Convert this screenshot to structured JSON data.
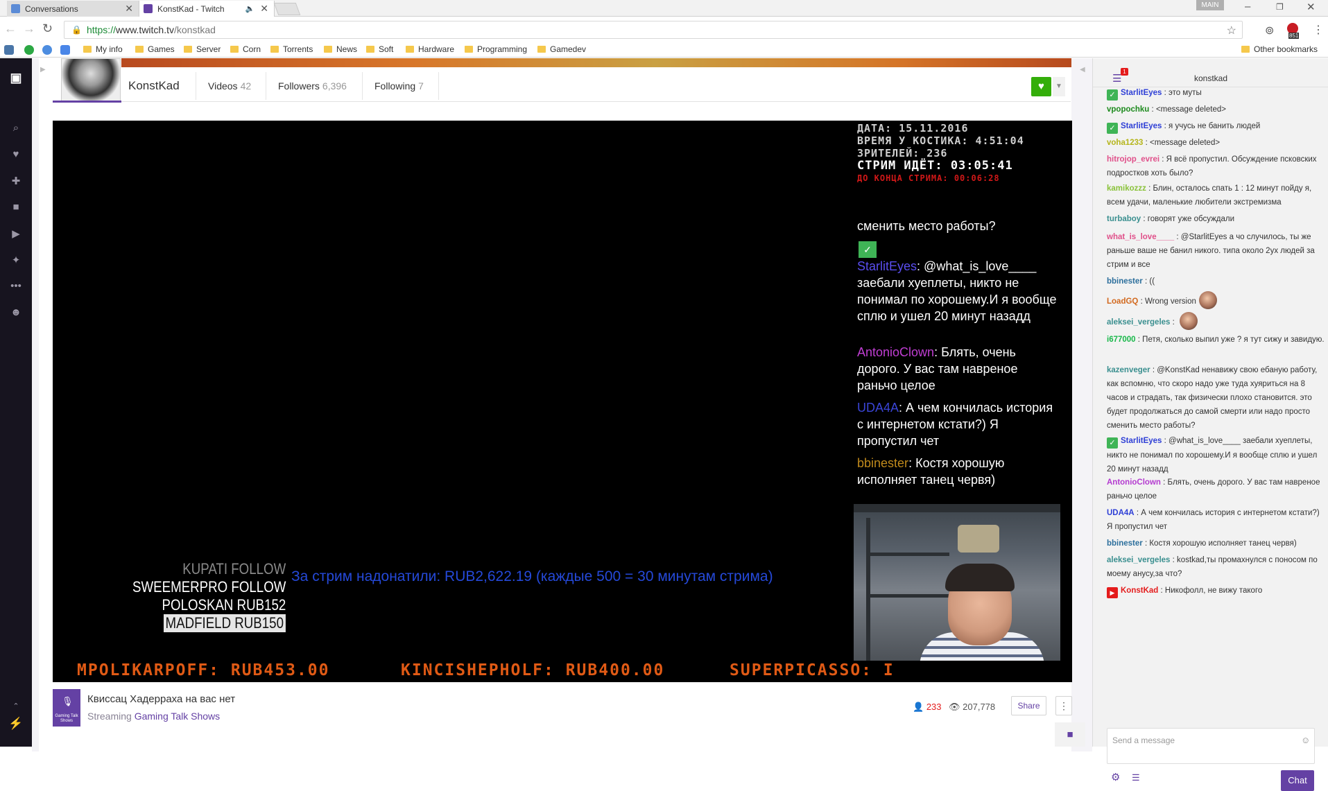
{
  "browser": {
    "tabs": [
      {
        "title": "Conversations",
        "favicon_color": "#5b8bd6"
      },
      {
        "title": "KonstKad - Twitch",
        "favicon_color": "#6441a4"
      }
    ],
    "profile_badge": "MAIN",
    "url": {
      "scheme": "https://",
      "host": "www.twitch.tv",
      "path": "/konstkad"
    },
    "bookmarks": [
      "My info",
      "Games",
      "Server",
      "Corn",
      "Torrents",
      "News",
      "Soft",
      "Hardware",
      "Programming",
      "Gamedev"
    ],
    "other_bookmarks": "Other bookmarks",
    "extension_badge": "851"
  },
  "channel": {
    "name": "KonstKad",
    "stats": [
      {
        "label": "Videos",
        "value": "42"
      },
      {
        "label": "Followers",
        "value": "6,396"
      },
      {
        "label": "Following",
        "value": "7"
      }
    ]
  },
  "player": {
    "info_lines": [
      "ДАТА: 15.11.2016",
      "ВРЕМЯ У КОСТИКА: 4:51:04",
      "ЗРИТЕЛЕЙ: 236",
      "СТРИМ ИДЁТ: 03:05:41",
      "ДО КОНЦА СТРИМА: 00:06:28"
    ],
    "overlay_chat_intro": "сменить место работы?",
    "overlay_chat": [
      {
        "user": "StarlitEyes",
        "text": "@what_is_love____ заебали хуеплеты, никто не понимал по хорошему.И я вообще сплю и ушел 20 минут назадд",
        "color": "#5a4ef0"
      },
      {
        "user": "AntonioClown",
        "text": "Блять, очень дорого. У вас там навреное раньчо целое",
        "color": "#c03ed3"
      },
      {
        "user": "UDA4A",
        "text": "А чем кончилась история с интернетом кстати?) Я пропустил чет",
        "color": "#3a45d6"
      },
      {
        "user": "bbinester",
        "text": "Костя хорошую исполняет танец червя)",
        "color": "#c08a1c"
      }
    ],
    "donors": [
      {
        "name": "KUPATI",
        "amount": "FOLLOW"
      },
      {
        "name": "SWEEMERPRO",
        "amount": "FOLLOW"
      },
      {
        "name": "POLOSKAN",
        "amount": "RUB152"
      },
      {
        "name": "MADFIELD",
        "amount": "RUB150"
      }
    ],
    "donation_total": "За стрим надонатили: RUB2,622.19 (каждые 500 = 30 минутам стрима)",
    "ticker": [
      "MPOLIKARPOFF: RUB453.00",
      "KINCISHEPHOLF: RUB400.00",
      "SUPERPICASSO: I"
    ]
  },
  "stream": {
    "title": "Квиссац Хадерраха на вас нет",
    "streaming_prefix": "Streaming",
    "category": "Gaming Talk Shows",
    "game_box_label": "Gaming Talk Shows",
    "viewers": "233",
    "views": "207,778",
    "share_label": "Share"
  },
  "chat": {
    "title": "konstkad",
    "notification_count": "1",
    "messages": [
      {
        "user": "StarlitEyes",
        "color": "#2e3fd6",
        "badge": "mod",
        "text": "это муты"
      },
      {
        "user": "vpopochku",
        "color": "#1d8a1d",
        "text": "<message deleted>"
      },
      {
        "user": "StarlitEyes",
        "color": "#2e3fd6",
        "badge": "mod",
        "text": "я учусь не банить людей"
      },
      {
        "user": "voha1233",
        "color": "#b5b51a",
        "text": "<message deleted>"
      },
      {
        "user": "hitrojop_evrei",
        "color": "#e0508a",
        "text": "Я всё пропустил. Обсуждение псковских подростков хоть было?"
      },
      {
        "user": "kamikozzz",
        "color": "#8ac23a",
        "text": "Блин, осталось спать 1 : 12 минут пойду я, всем удачи, маленькие любители экстремизма"
      },
      {
        "user": "turbaboy",
        "color": "#3a8f8f",
        "text": "говорят уже обсуждали"
      },
      {
        "user": "what_is_love____",
        "color": "#e0508a",
        "text": "@StarlitEyes а чо случилось, ты же раньше ваше не банил никого. типа около 2ух людей за стрим и все"
      },
      {
        "user": "bbinester",
        "color": "#2c6f9c",
        "text": "(("
      },
      {
        "user": "LoadGQ",
        "color": "#d2691e",
        "text": "Wrong version"
      },
      {
        "user": "aleksei_vergeles",
        "color": "#3a8f8f",
        "text": ""
      },
      {
        "user": "i677000",
        "color": "#19b84a",
        "text": "Петя, сколько выпил уже ? я тут сижу и завидую."
      },
      {
        "user": "kazenveger",
        "color": "#3a8f8f",
        "text": "@KonstKad ненавижу свою ебаную работу, как вспомню, что скоро надо уже туда хуяриться на 8 часов и страдать, так физически плохо становится. это будет продолжаться до самой смерти или надо просто сменить место работы?"
      },
      {
        "user": "StarlitEyes",
        "color": "#2e3fd6",
        "badge": "mod",
        "text": "@what_is_love____ заебали хуеплеты, никто не понимал по хорошему.И я вообще сплю и ушел 20 минут назадд"
      },
      {
        "user": "AntonioClown",
        "color": "#b43bd0",
        "text": "Блять, очень дорого. У вас там навреное раньчо целое"
      },
      {
        "user": "UDA4A",
        "color": "#2e3fd6",
        "text": "А чем кончилась история с интернетом кстати?) Я пропустил чет"
      },
      {
        "user": "bbinester",
        "color": "#2c6f9c",
        "text": "Костя хорошую исполняет танец червя)"
      },
      {
        "user": "aleksei_vergeles",
        "color": "#3a8f8f",
        "text": "kostkad,ты промахнулся с поносом по моему анусу,за что?"
      },
      {
        "user": "KonstKad",
        "color": "#e41c1c",
        "badge": "broadcaster",
        "text": "Никофолл, не вижу такого"
      }
    ],
    "input_placeholder": "Send a message",
    "send_label": "Chat"
  }
}
